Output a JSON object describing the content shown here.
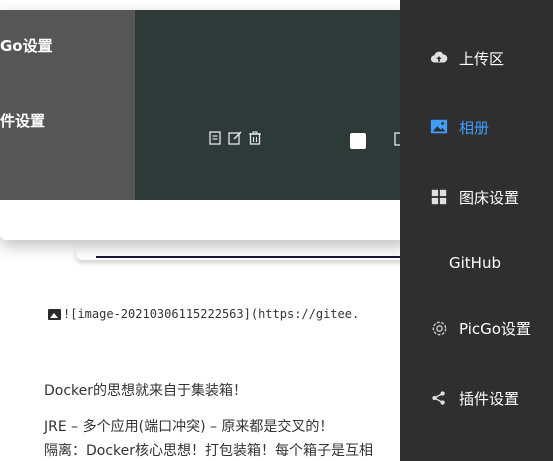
{
  "document": {
    "markdown_line": "![image-20210306115222563](https://gitee.",
    "paragraphs": [
      "Docker的思想就来自于集装箱！",
      "JRE – 多个应用(端口冲突) – 原来都是交叉的！",
      "隔离：Docker核心思想！打包装箱！每个箱子是互相"
    ]
  },
  "dialog": {
    "left_items": [
      "Go设置",
      "件设置"
    ]
  },
  "sidebar": {
    "items": [
      {
        "label": "上传区",
        "icon": "cloud-upload-icon",
        "active": false
      },
      {
        "label": "相册",
        "icon": "picture-icon",
        "active": true
      },
      {
        "label": "图床设置",
        "icon": "grid-icon",
        "active": false
      },
      {
        "label": "GitHub",
        "icon": "",
        "active": false
      },
      {
        "label": "PicGo设置",
        "icon": "gear-icon",
        "active": false
      },
      {
        "label": "插件设置",
        "icon": "share-icon",
        "active": false
      }
    ],
    "active_color": "#409eff",
    "background": "#2f2f2f"
  }
}
